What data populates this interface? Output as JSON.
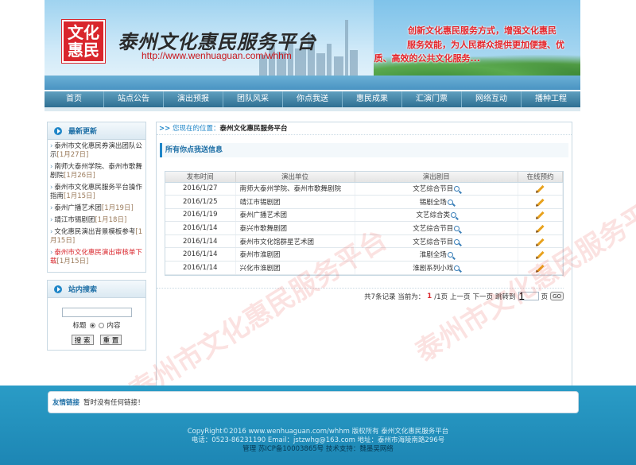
{
  "banner": {
    "logo_line1": "文化",
    "logo_line2": "惠民",
    "site_title": "泰州文化惠民服务平台",
    "site_url": "http://www.wenhuaguan.com/whhm",
    "slogan_line1": "创新文化惠民服务方式，增强文化惠民",
    "slogan_line2": "服务效能，为人民群众提供更加便捷、优",
    "slogan_line3": "质、高效的公共文化服务..."
  },
  "nav": {
    "items": [
      "首页",
      "站点公告",
      "演出预报",
      "团队风采",
      "你点我送",
      "惠民成果",
      "汇演门票",
      "网络互动",
      "播种工程"
    ]
  },
  "sidebar": {
    "latest_title": "最新更新",
    "news": [
      {
        "title": "泰州市文化惠民券演出团队公示",
        "date": "[1月27日]"
      },
      {
        "title": "南师大泰州学院、泰州市歌舞剧院",
        "date": "[1月26日]"
      },
      {
        "title": "泰州市文化惠民服务平台操作指南",
        "date": "[1月15日]"
      },
      {
        "title": "泰州广播艺术团",
        "date": "[1月19日]"
      },
      {
        "title": "靖江市锡剧团",
        "date": "[1月18日]"
      },
      {
        "title": "文化惠民演出背景模板参考",
        "date": "[1月15日]"
      },
      {
        "title": "泰州市文化惠民演出审核单下载",
        "date": "[1月15日]"
      }
    ],
    "search_title": "站内搜索",
    "radio_title": "标题",
    "radio_content": "内容",
    "btn_search": "搜 索",
    "btn_reset": "重 置"
  },
  "main": {
    "crumb_label": "您现在的位置：",
    "crumb_value": "泰州文化惠民服务平台",
    "section_title": "所有你点我送信息",
    "columns": [
      "发布时间",
      "演出单位",
      "演出剧目",
      "在线预约"
    ],
    "rows": [
      {
        "date": "2016/1/27",
        "unit": "南师大泰州学院、泰州市歌舞剧院",
        "program": "文艺综合节目"
      },
      {
        "date": "2016/1/25",
        "unit": "靖江市锡剧团",
        "program": "锡剧全场"
      },
      {
        "date": "2016/1/19",
        "unit": "泰州广播艺术团",
        "program": "文艺综合类"
      },
      {
        "date": "2016/1/14",
        "unit": "泰兴市歌舞剧团",
        "program": "文艺综合节目"
      },
      {
        "date": "2016/1/14",
        "unit": "泰州市文化馆群星艺术团",
        "program": "文艺综合节目"
      },
      {
        "date": "2016/1/14",
        "unit": "泰州市淮剧团",
        "program": "淮剧全场"
      },
      {
        "date": "2016/1/14",
        "unit": "兴化市淮剧团",
        "program": "淮剧系列小戏"
      }
    ],
    "pager": {
      "total": "共7条记录 当前为：",
      "current": "1",
      "of": "/1页",
      "prev": "上一页",
      "next": "下一页",
      "jump": "跳转到",
      "jump_value": "1",
      "page_unit": "页",
      "go": "GO"
    }
  },
  "watermark": {
    "text1": "泰州市文化惠民服务平台",
    "text2": "泰州市文化惠民服务平台"
  },
  "footer": {
    "links_title": "友情链接",
    "links_empty": "暂时没有任何链接！",
    "line1": "CopyRight©2016 www.wenhuaguan.com/whhm 版权所有 泰州文化惠民服务平台",
    "line2": "电话：0523-86231190 Email：jstzwhg@163.com 地址：泰州市海陵南路296号",
    "line3": "管理 苏ICP备10003865号 技术支持：魏墨吴网络"
  }
}
